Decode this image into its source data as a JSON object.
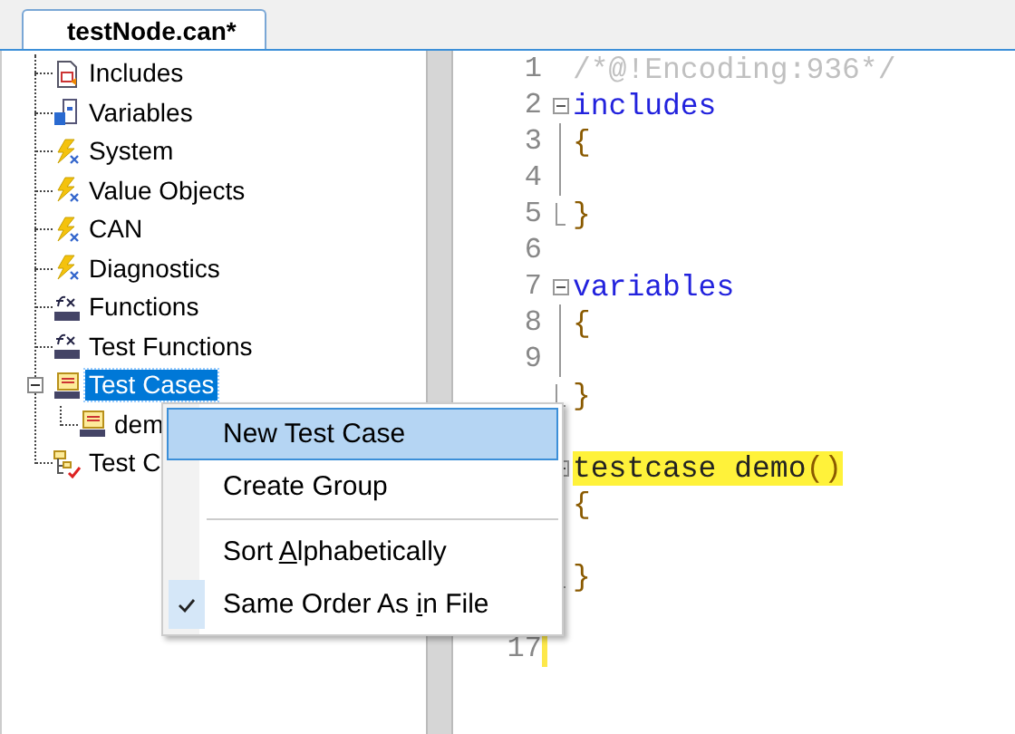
{
  "tab": {
    "label": "testNode.can*",
    "selected": true
  },
  "tree": {
    "items": [
      {
        "label": "Includes",
        "kind": "include",
        "selected": false
      },
      {
        "label": "Variables",
        "kind": "variables",
        "selected": false
      },
      {
        "label": "System",
        "kind": "event",
        "selected": false
      },
      {
        "label": "Value Objects",
        "kind": "event",
        "selected": false
      },
      {
        "label": "CAN",
        "kind": "event",
        "selected": false
      },
      {
        "label": "Diagnostics",
        "kind": "event",
        "selected": false
      },
      {
        "label": "Functions",
        "kind": "function",
        "selected": false
      },
      {
        "label": "Test Functions",
        "kind": "function",
        "selected": false
      },
      {
        "label": "Test Cases",
        "kind": "testcase",
        "selected": true,
        "expanded": true,
        "children": [
          {
            "label": "dem",
            "kind": "testcase",
            "selected": false
          }
        ]
      },
      {
        "label": "Test C",
        "kind": "testgroup",
        "selected": false
      }
    ]
  },
  "editor": {
    "lines": [
      {
        "number": "1",
        "changed": false,
        "tokens": [
          {
            "text": "/*@!Encoding:936*/",
            "kind": "comment",
            "highlighted": false
          }
        ]
      },
      {
        "number": "2",
        "kind": "fold_start",
        "changed": false,
        "tokens": [
          {
            "text": "includes",
            "kind": "keyword",
            "highlighted": false
          }
        ]
      },
      {
        "number": "3",
        "kind": "fold_line",
        "changed": false,
        "tokens": [
          {
            "text": "{",
            "kind": "brace",
            "highlighted": false
          }
        ]
      },
      {
        "number": "4",
        "kind": "fold_line",
        "changed": false
      },
      {
        "number": "5",
        "kind": "fold_end",
        "changed": false,
        "tokens": [
          {
            "text": "}",
            "kind": "brace",
            "highlighted": false
          }
        ]
      },
      {
        "number": "6",
        "changed": false
      },
      {
        "number": "7",
        "kind": "fold_start",
        "changed": false,
        "tokens": [
          {
            "text": "variables",
            "kind": "keyword",
            "highlighted": false
          }
        ]
      },
      {
        "number": "8",
        "kind": "fold_line",
        "changed": false,
        "tokens": [
          {
            "text": "{",
            "kind": "brace",
            "highlighted": false
          }
        ]
      },
      {
        "number": "9",
        "kind": "fold_line",
        "changed": false
      },
      {
        "kind": "fold_end",
        "changed": false,
        "tokens": [
          {
            "text": "}",
            "kind": "brace",
            "highlighted": false
          }
        ]
      },
      {
        "kind": "blank"
      },
      {
        "kind": "fold_start",
        "tokens": [
          {
            "text": "testcase demo",
            "kind": "plain",
            "highlighted": true
          },
          {
            "text": "()",
            "kind": "brace",
            "highlighted": true
          }
        ]
      },
      {
        "kind": "fold_line",
        "tokens": [
          {
            "text": "{",
            "kind": "brace",
            "highlighted": false
          }
        ]
      },
      {
        "kind": "fold_line"
      },
      {
        "kind": "fold_end",
        "tokens": [
          {
            "text": "}",
            "kind": "brace",
            "highlighted": false
          }
        ]
      },
      {
        "kind": "blank"
      },
      {
        "number": "17",
        "changed": true
      }
    ]
  },
  "context_menu": {
    "items": [
      {
        "kind": "item",
        "text_before": "New Test Case",
        "selected": true,
        "checked": false
      },
      {
        "kind": "item",
        "text_before": "Create Group",
        "selected": false,
        "checked": false
      },
      {
        "kind": "separator"
      },
      {
        "kind": "item",
        "text_before": "Sort ",
        "accesskey": "A",
        "text_after": "lphabetically",
        "selected": false,
        "checked": false
      },
      {
        "kind": "item",
        "text_before": "Same Order As ",
        "accesskey": "i",
        "text_after": "n File",
        "selected": false,
        "checked": true
      }
    ]
  }
}
